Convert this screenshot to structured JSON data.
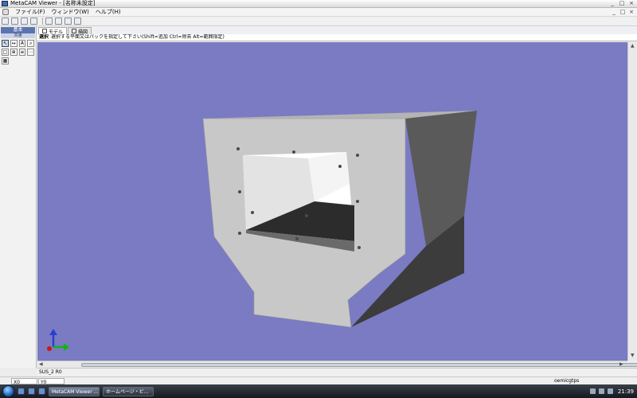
{
  "window": {
    "title": "MetaCAM Viewer - [名称未設定]",
    "controls": [
      "_",
      "□",
      "×"
    ]
  },
  "menubar": {
    "items": [
      "ファイル(F)",
      "ウィンドウ(W)",
      "ヘルプ(H)"
    ],
    "mdi_controls": [
      "_",
      "□",
      "×"
    ]
  },
  "toolbar": {
    "icons": [
      "new-icon",
      "open-icon",
      "save-icon",
      "print-icon",
      "copy-icon",
      "zoom-icon",
      "fit-icon",
      "rotate-icon"
    ]
  },
  "sidebar": {
    "header": "基本",
    "subheader": "共通",
    "tools": [
      "↖",
      "↔",
      "A",
      "⌕",
      "□",
      "⊕",
      "≡",
      "⋯",
      "▦"
    ],
    "icons": [
      "select-arrow-icon",
      "move-icon",
      "text-icon",
      "zoom-icon",
      "frame-icon",
      "target-icon",
      "list-icon",
      "more-icon",
      "grid-icon"
    ]
  },
  "tabs": [
    {
      "label": "モデル",
      "icon": "model-tab-icon"
    },
    {
      "label": "描図",
      "icon": "draw-tab-icon"
    }
  ],
  "hint": {
    "label": "選択",
    "text": "選択する平面又はパックを指定して下さい(Shift=追加 Ctrl=除去 Alt=範囲指定)"
  },
  "viewport": {
    "background": "#7a7bc3",
    "model_color": "#c8c8c8"
  },
  "status": {
    "material": "SUS_2 R0",
    "x": "X0",
    "y": "Y0",
    "right": "oemicgtps"
  },
  "taskbar": {
    "tasks": [
      "MetaCAM Viewer ...",
      "ホームページ・ビ..."
    ],
    "clock": "21:39"
  }
}
